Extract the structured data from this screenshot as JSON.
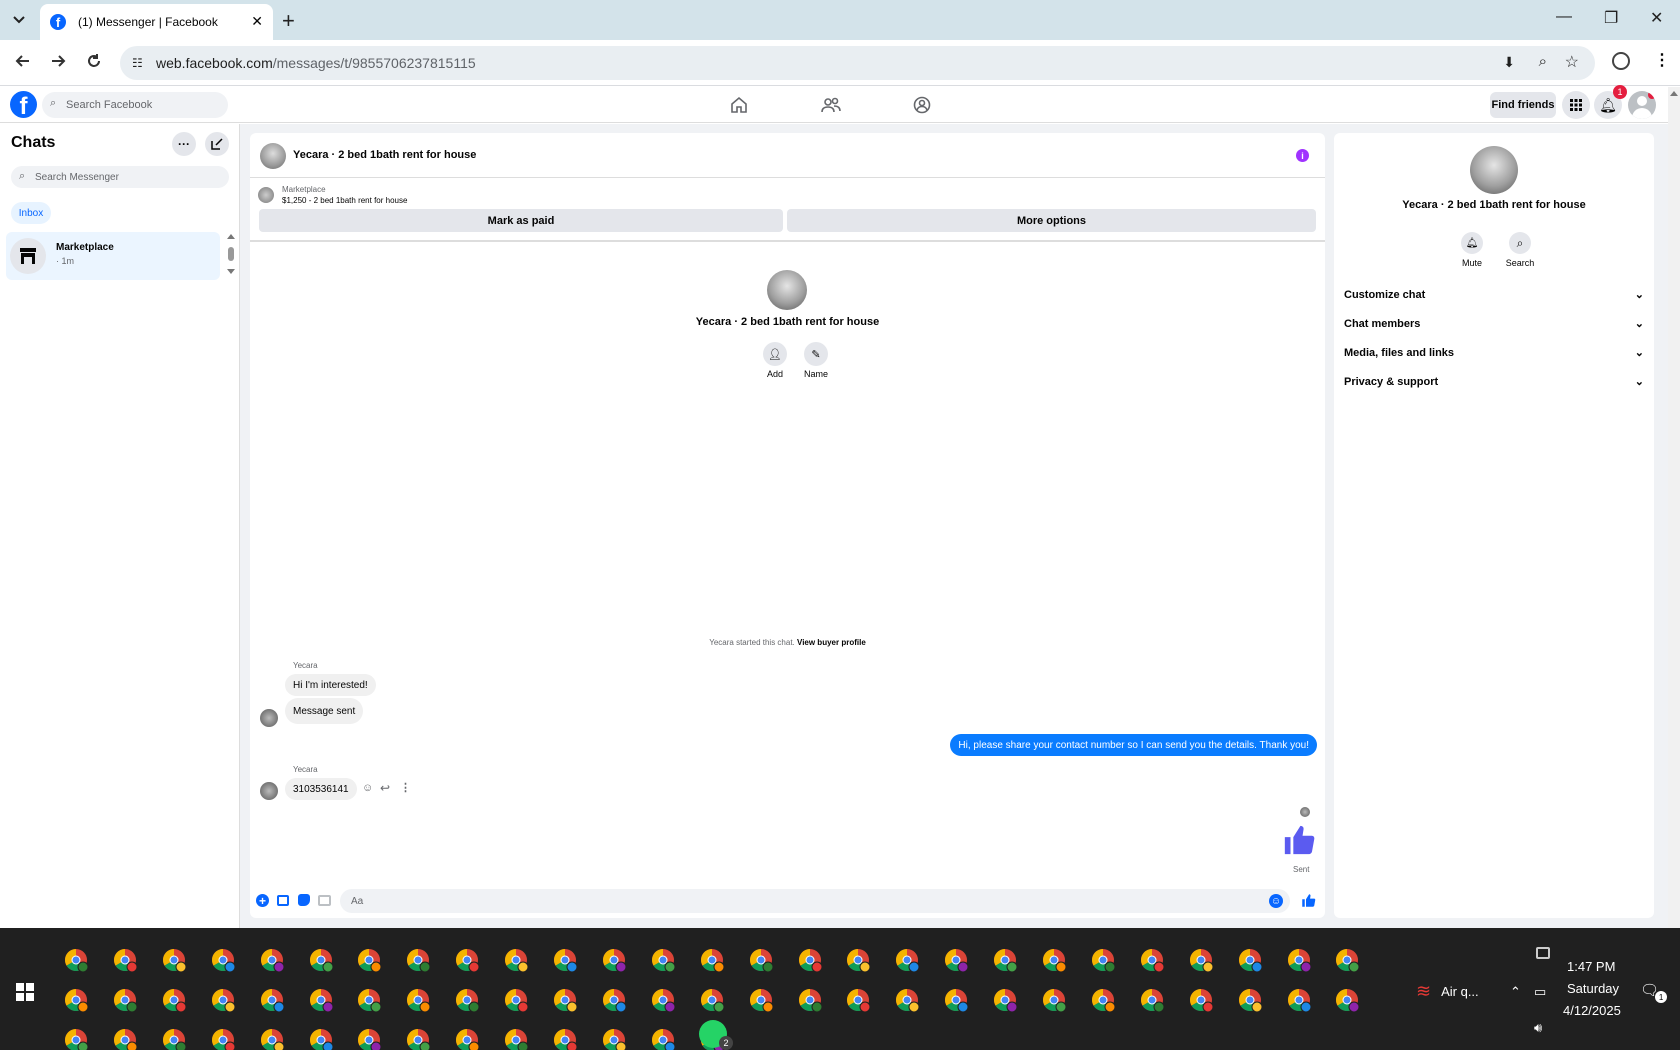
{
  "browser": {
    "tab_title": "(1) Messenger | Facebook",
    "url_domain": "web.facebook.com",
    "url_path": "/messages/t/9855706237815115"
  },
  "fb": {
    "search_placeholder": "Search Facebook",
    "find_friends": "Find friends",
    "notification_count": "1"
  },
  "left": {
    "title": "Chats",
    "search_placeholder": "Search Messenger",
    "filter": "Inbox",
    "chats": [
      {
        "name": "Marketplace",
        "meta": "· 1m"
      }
    ]
  },
  "chat": {
    "title": "Yecara · 2 bed 1bath rent for house",
    "listing_source": "Marketplace",
    "listing_text": "$1,250 - 2 bed 1bath rent for house",
    "mark_paid": "Mark as paid",
    "more_options": "More options",
    "intro_name": "Yecara · 2 bed 1bath rent for house",
    "add_label": "Add",
    "name_label": "Name",
    "started_text": "Yecara started this chat.",
    "view_profile": "View buyer profile",
    "sender1": "Yecara",
    "msg1": "Hi I'm interested!",
    "msg2": "Message sent",
    "msg_out": "Hi, please share your contact number so I can send you the details. Thank you!",
    "sender2": "Yecara",
    "msg3": "3103536141",
    "sent_status": "Sent",
    "composer_placeholder": "Aa"
  },
  "rpanel": {
    "name": "Yecara · 2 bed 1bath rent for house",
    "mute": "Mute",
    "search": "Search",
    "sections": [
      "Customize chat",
      "Chat members",
      "Media, files and links",
      "Privacy & support"
    ]
  },
  "taskbar": {
    "time": "1:47 PM",
    "day": "Saturday",
    "date": "4/12/2025",
    "weather": "Air q...",
    "whatsapp_badge": "2",
    "notif_count": "1"
  },
  "colors": {
    "fb_blue": "#0866ff",
    "messenger_blue": "#0a7cff",
    "like_purple": "#5b5bf0",
    "info_purple": "#a033ff"
  }
}
